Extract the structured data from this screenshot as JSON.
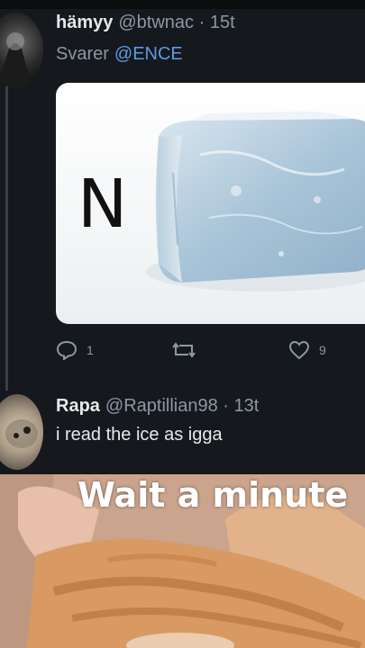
{
  "tweet": {
    "display_name": "hämyy",
    "handle": "@btwnac · 15t",
    "replying_prefix": "Svarer",
    "replying_to": "@ENCE",
    "media_letter": "N",
    "replies_count": "1",
    "likes_count": "9",
    "icons": {
      "reply": "reply-icon",
      "retweet": "retweet-icon",
      "like": "heart-icon"
    }
  },
  "reply": {
    "display_name": "Rapa",
    "handle": "@Raptillian98 · 13t",
    "text": "i read the ice as igga"
  },
  "video": {
    "caption": "Wait a minute"
  },
  "colors": {
    "background": "#15181d",
    "accent": "#5b9be6",
    "muted": "#8b98a5"
  }
}
